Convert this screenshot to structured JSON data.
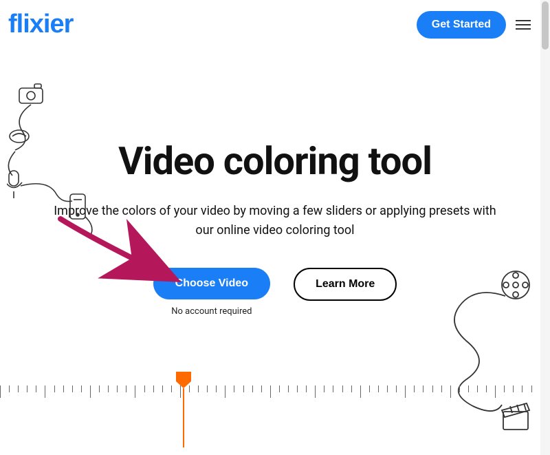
{
  "header": {
    "logo": "flixier",
    "get_started": "Get Started"
  },
  "hero": {
    "title": "Video coloring tool",
    "subtitle": "Improve the colors of your video by moving a few sliders or applying presets with our online video coloring tool",
    "choose_video": "Choose Video",
    "hint": "No account required",
    "learn_more": "Learn More"
  },
  "colors": {
    "primary": "#1a7ef7",
    "accent": "#ff6a00",
    "arrow": "#b5175b"
  }
}
